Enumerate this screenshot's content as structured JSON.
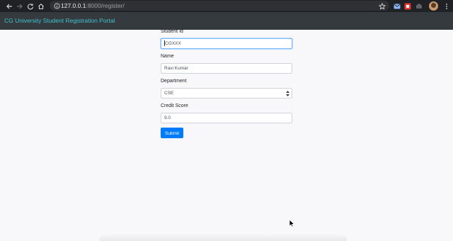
{
  "browser": {
    "url_host": "127.0.0.1",
    "url_rest": ":8000/register/",
    "icons": [
      "back-icon",
      "forward-icon",
      "reload-icon",
      "home-icon",
      "info-icon",
      "star-icon",
      "mail-icon",
      "extension-icon",
      "extension-icon",
      "menu-icon"
    ]
  },
  "navbar": {
    "brand": "CG University Student Registration Portal"
  },
  "form": {
    "student_id": {
      "label": "Student Id",
      "value": "CGXXX"
    },
    "name": {
      "label": "Name",
      "value": "Ravi Kumar"
    },
    "department": {
      "label": "Department",
      "selected": "CSE"
    },
    "credit_score": {
      "label": "Credit Score",
      "value": "9.0"
    },
    "submit_label": "Submit"
  },
  "colors": {
    "browser_chrome": "#202124",
    "navbar_bg": "#353a3f",
    "brand_text": "#3ec3cf",
    "page_bg": "#f8f8fa",
    "button": "#007bff",
    "focus_border": "#80bdff"
  }
}
